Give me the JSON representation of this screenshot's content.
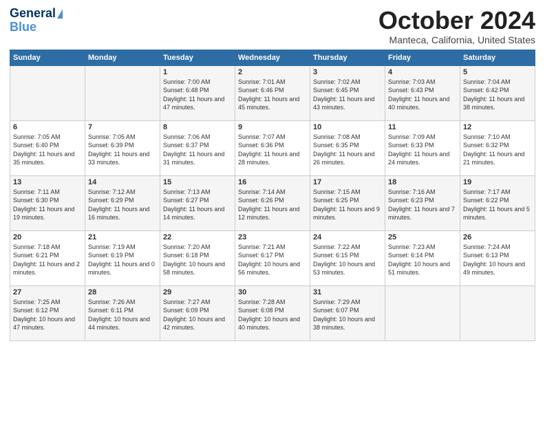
{
  "header": {
    "logo_line1": "General",
    "logo_line2": "Blue",
    "month_title": "October 2024",
    "subtitle": "Manteca, California, United States"
  },
  "days_of_week": [
    "Sunday",
    "Monday",
    "Tuesday",
    "Wednesday",
    "Thursday",
    "Friday",
    "Saturday"
  ],
  "weeks": [
    [
      {
        "day": "",
        "info": ""
      },
      {
        "day": "",
        "info": ""
      },
      {
        "day": "1",
        "info": "Sunrise: 7:00 AM\nSunset: 6:48 PM\nDaylight: 11 hours and 47 minutes."
      },
      {
        "day": "2",
        "info": "Sunrise: 7:01 AM\nSunset: 6:46 PM\nDaylight: 11 hours and 45 minutes."
      },
      {
        "day": "3",
        "info": "Sunrise: 7:02 AM\nSunset: 6:45 PM\nDaylight: 11 hours and 43 minutes."
      },
      {
        "day": "4",
        "info": "Sunrise: 7:03 AM\nSunset: 6:43 PM\nDaylight: 11 hours and 40 minutes."
      },
      {
        "day": "5",
        "info": "Sunrise: 7:04 AM\nSunset: 6:42 PM\nDaylight: 11 hours and 38 minutes."
      }
    ],
    [
      {
        "day": "6",
        "info": "Sunrise: 7:05 AM\nSunset: 6:40 PM\nDaylight: 11 hours and 35 minutes."
      },
      {
        "day": "7",
        "info": "Sunrise: 7:05 AM\nSunset: 6:39 PM\nDaylight: 11 hours and 33 minutes."
      },
      {
        "day": "8",
        "info": "Sunrise: 7:06 AM\nSunset: 6:37 PM\nDaylight: 11 hours and 31 minutes."
      },
      {
        "day": "9",
        "info": "Sunrise: 7:07 AM\nSunset: 6:36 PM\nDaylight: 11 hours and 28 minutes."
      },
      {
        "day": "10",
        "info": "Sunrise: 7:08 AM\nSunset: 6:35 PM\nDaylight: 11 hours and 26 minutes."
      },
      {
        "day": "11",
        "info": "Sunrise: 7:09 AM\nSunset: 6:33 PM\nDaylight: 11 hours and 24 minutes."
      },
      {
        "day": "12",
        "info": "Sunrise: 7:10 AM\nSunset: 6:32 PM\nDaylight: 11 hours and 21 minutes."
      }
    ],
    [
      {
        "day": "13",
        "info": "Sunrise: 7:11 AM\nSunset: 6:30 PM\nDaylight: 11 hours and 19 minutes."
      },
      {
        "day": "14",
        "info": "Sunrise: 7:12 AM\nSunset: 6:29 PM\nDaylight: 11 hours and 16 minutes."
      },
      {
        "day": "15",
        "info": "Sunrise: 7:13 AM\nSunset: 6:27 PM\nDaylight: 11 hours and 14 minutes."
      },
      {
        "day": "16",
        "info": "Sunrise: 7:14 AM\nSunset: 6:26 PM\nDaylight: 11 hours and 12 minutes."
      },
      {
        "day": "17",
        "info": "Sunrise: 7:15 AM\nSunset: 6:25 PM\nDaylight: 11 hours and 9 minutes."
      },
      {
        "day": "18",
        "info": "Sunrise: 7:16 AM\nSunset: 6:23 PM\nDaylight: 11 hours and 7 minutes."
      },
      {
        "day": "19",
        "info": "Sunrise: 7:17 AM\nSunset: 6:22 PM\nDaylight: 11 hours and 5 minutes."
      }
    ],
    [
      {
        "day": "20",
        "info": "Sunrise: 7:18 AM\nSunset: 6:21 PM\nDaylight: 11 hours and 2 minutes."
      },
      {
        "day": "21",
        "info": "Sunrise: 7:19 AM\nSunset: 6:19 PM\nDaylight: 11 hours and 0 minutes."
      },
      {
        "day": "22",
        "info": "Sunrise: 7:20 AM\nSunset: 6:18 PM\nDaylight: 10 hours and 58 minutes."
      },
      {
        "day": "23",
        "info": "Sunrise: 7:21 AM\nSunset: 6:17 PM\nDaylight: 10 hours and 56 minutes."
      },
      {
        "day": "24",
        "info": "Sunrise: 7:22 AM\nSunset: 6:15 PM\nDaylight: 10 hours and 53 minutes."
      },
      {
        "day": "25",
        "info": "Sunrise: 7:23 AM\nSunset: 6:14 PM\nDaylight: 10 hours and 51 minutes."
      },
      {
        "day": "26",
        "info": "Sunrise: 7:24 AM\nSunset: 6:13 PM\nDaylight: 10 hours and 49 minutes."
      }
    ],
    [
      {
        "day": "27",
        "info": "Sunrise: 7:25 AM\nSunset: 6:12 PM\nDaylight: 10 hours and 47 minutes."
      },
      {
        "day": "28",
        "info": "Sunrise: 7:26 AM\nSunset: 6:11 PM\nDaylight: 10 hours and 44 minutes."
      },
      {
        "day": "29",
        "info": "Sunrise: 7:27 AM\nSunset: 6:09 PM\nDaylight: 10 hours and 42 minutes."
      },
      {
        "day": "30",
        "info": "Sunrise: 7:28 AM\nSunset: 6:08 PM\nDaylight: 10 hours and 40 minutes."
      },
      {
        "day": "31",
        "info": "Sunrise: 7:29 AM\nSunset: 6:07 PM\nDaylight: 10 hours and 38 minutes."
      },
      {
        "day": "",
        "info": ""
      },
      {
        "day": "",
        "info": ""
      }
    ]
  ]
}
